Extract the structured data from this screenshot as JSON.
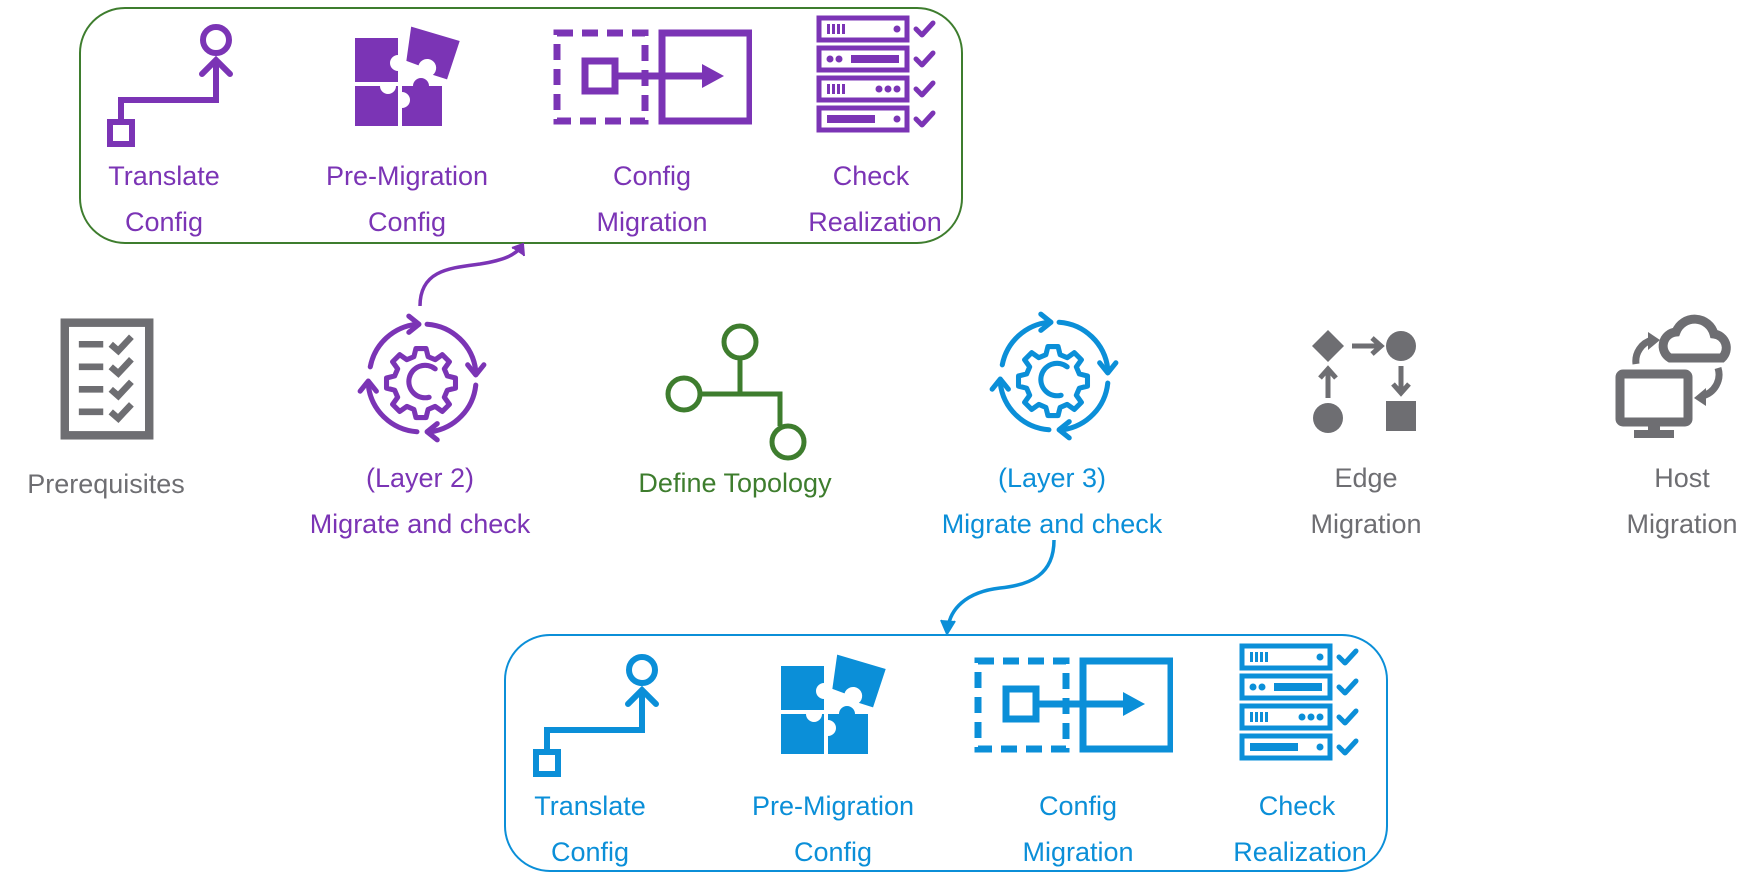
{
  "colors": {
    "purple": "#7b34b5",
    "blue": "#0b8fd8",
    "green": "#3e7d2e",
    "gray": "#6e6e72"
  },
  "layer2_detail": {
    "steps": [
      {
        "line1": "Translate",
        "line2": "Config",
        "icon": "translate-config-icon"
      },
      {
        "line1": "Pre-Migration",
        "line2": "Config",
        "icon": "puzzle-icon"
      },
      {
        "line1": "Config",
        "line2": "Migration",
        "icon": "config-migration-icon"
      },
      {
        "line1": "Check",
        "line2": "Realization",
        "icon": "server-check-icon"
      }
    ]
  },
  "main_flow": {
    "steps": [
      {
        "line1": "Prerequisites",
        "line2": "",
        "icon": "checklist-icon"
      },
      {
        "line1": "(Layer 2)",
        "line2": "Migrate and check",
        "icon": "cycle-gear-icon"
      },
      {
        "line1": "Define Topology",
        "line2": "",
        "icon": "topology-icon"
      },
      {
        "line1": "(Layer 3)",
        "line2": "Migrate and check",
        "icon": "cycle-gear-icon"
      },
      {
        "line1": "Edge",
        "line2": "Migration",
        "icon": "edge-flow-icon"
      },
      {
        "line1": "Host",
        "line2": "Migration",
        "icon": "host-cloud-icon"
      }
    ]
  },
  "layer3_detail": {
    "steps": [
      {
        "line1": "Translate",
        "line2": "Config",
        "icon": "translate-config-icon"
      },
      {
        "line1": "Pre-Migration",
        "line2": "Config",
        "icon": "puzzle-icon"
      },
      {
        "line1": "Config",
        "line2": "Migration",
        "icon": "config-migration-icon"
      },
      {
        "line1": "Check",
        "line2": "Realization",
        "icon": "server-check-icon"
      }
    ]
  }
}
